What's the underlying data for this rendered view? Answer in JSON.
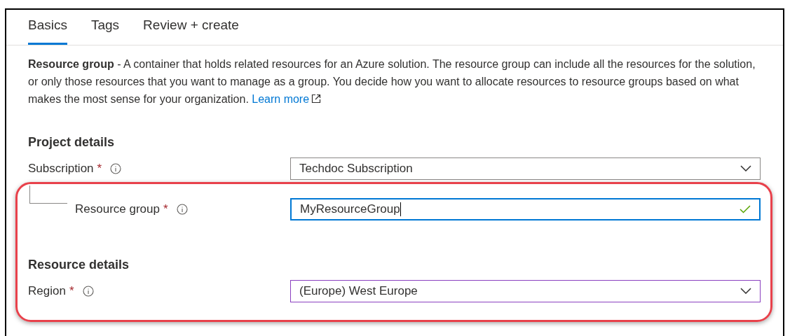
{
  "tabs": [
    {
      "label": "Basics",
      "selected": true
    },
    {
      "label": "Tags",
      "selected": false
    },
    {
      "label": "Review + create",
      "selected": false
    }
  ],
  "description": {
    "text": "**Resource group** - A container that holds related resources for an Azure solution. The resource group can include all the resources for the solution, or only those resources that you want to manage as a group. You decide how you want to allocate resources to resource groups based on what makes the most sense for your organization.",
    "link": "Learn more"
  },
  "sections": [
    {
      "heading": "Project details",
      "fields": [
        {
          "label": "Subscription",
          "required_mark": "*",
          "kind": "dropdown",
          "value": "Techdoc Subscription",
          "focused": false,
          "hovered": false,
          "children": [
            {
              "label": "Resource group",
              "required_mark": "*",
              "kind": "text",
              "value": "MyResourceGroup",
              "focused": true,
              "valid": true
            }
          ]
        }
      ]
    },
    {
      "heading": "Resource details",
      "fields": [
        {
          "label": "Region",
          "required_mark": "*",
          "kind": "dropdown",
          "value": "(Europe) West Europe",
          "focused": false,
          "hovered": true
        }
      ]
    }
  ]
}
